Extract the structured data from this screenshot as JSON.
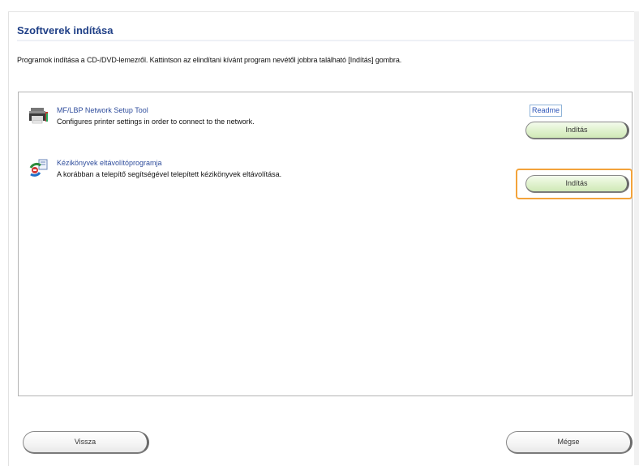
{
  "page": {
    "title": "Szoftverek indítása",
    "instructions": "Programok indítása a CD-/DVD-lemezről. Kattintson az elindítani kívánt program nevétől jobbra található [Indítás] gombra."
  },
  "programs": [
    {
      "name": "MF/LBP Network Setup Tool",
      "description": "Configures printer settings in order to connect to the network.",
      "readme_label": "Readme",
      "start_label": "Indítás",
      "icon": "printer-network-icon"
    },
    {
      "name": "Kézikönyvek eltávolítóprogramja",
      "description": "A korábban a telepítő segítségével telepített kézikönyvek eltávolítása.",
      "start_label": "Indítás",
      "icon": "uninstall-manuals-icon"
    }
  ],
  "footer": {
    "back_label": "Vissza",
    "cancel_label": "Mégse"
  },
  "colors": {
    "title": "#1f3f86",
    "link": "#2f4d9c",
    "focus": "#f3a33a",
    "button_green": "#e3f3d2"
  }
}
